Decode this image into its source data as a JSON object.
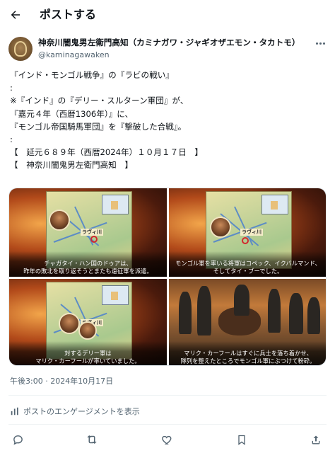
{
  "header": {
    "title": "ポストする"
  },
  "author": {
    "name": "神奈川闇鬼男左衛門高知（カミナガワ・ジャギオザエモン・タカトモ）",
    "handle": "@kaminagawaken"
  },
  "post": {
    "lines": [
      "『インド・モンゴル戦争』の『ラビの戦い』",
      ":",
      "※『インド』の『デリー・スルターン軍団』が、",
      "『嘉元４年（西暦1306年）』に、",
      "『モンゴル帝国騎馬軍団』を『撃破した合戦』。",
      ":",
      "【　延元６８９年（西暦2024年）１０月１７日　】",
      "【　神奈川闇鬼男左衛門高知　】"
    ]
  },
  "media": {
    "tiles": [
      {
        "caption": [
          "チャガタイ・ハン国のドゥアは、",
          "昨年の敗北を取り返そうとまたも遠征軍を派遣。"
        ],
        "city_label": "ラヴィ川"
      },
      {
        "caption": [
          "モンゴル軍を率いる将軍はコペック、イクバルマンド、",
          "そしてタイ・ブーでした。"
        ],
        "city_label": "ラヴィ川"
      },
      {
        "caption": [
          "対するデリー軍は",
          "マリク・カーフールが率いていました。"
        ],
        "city_label": "ラヴィ川"
      },
      {
        "caption": [
          "マリク・カーフールはすぐに兵士を落ち着かせ、",
          "隊列を整えたところでモンゴル軍にぶつけて粉砕。"
        ]
      }
    ]
  },
  "timestamp": "午後3:00 · 2024年10月17日",
  "engagement": {
    "label": "ポストのエンゲージメントを表示"
  },
  "actions": [
    "reply-icon",
    "repost-icon",
    "like-icon",
    "bookmark-icon",
    "share-icon"
  ],
  "colors": {
    "text": "#0f1419",
    "secondary": "#536471",
    "divider": "#eff3f4"
  }
}
